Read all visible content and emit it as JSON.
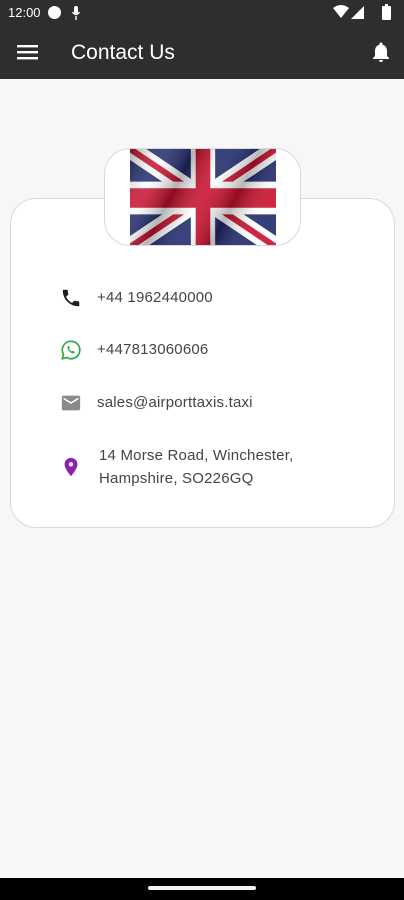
{
  "status_bar": {
    "time": "12:00",
    "icons": [
      "record-dot-icon",
      "mic-icon",
      "wifi-icon",
      "signal-icon",
      "battery-icon"
    ]
  },
  "app_bar": {
    "title": "Contact Us",
    "menu_icon": "hamburger-menu-icon",
    "notification_icon": "bell-icon"
  },
  "header_image": {
    "icon": "uk-flag"
  },
  "contacts": [
    {
      "icon": "phone-icon",
      "icon_color": "#1f1f1f",
      "text": "+44 1962440000"
    },
    {
      "icon": "whatsapp-icon",
      "icon_color": "#2ba84a",
      "text": "+447813060606"
    },
    {
      "icon": "email-icon",
      "icon_color": "#8a8a8a",
      "text": "sales@airporttaxis.taxi"
    },
    {
      "icon": "location-pin-icon",
      "icon_color": "#8e1fb5",
      "lines": [
        "14 Morse Road, Winchester,",
        "Hampshire, SO226GQ"
      ]
    }
  ],
  "colors": {
    "app_bar": "#2e2e2e",
    "page_background": "#f7f7f7",
    "card_background": "#ffffff",
    "card_border": "#d9d9d9"
  }
}
